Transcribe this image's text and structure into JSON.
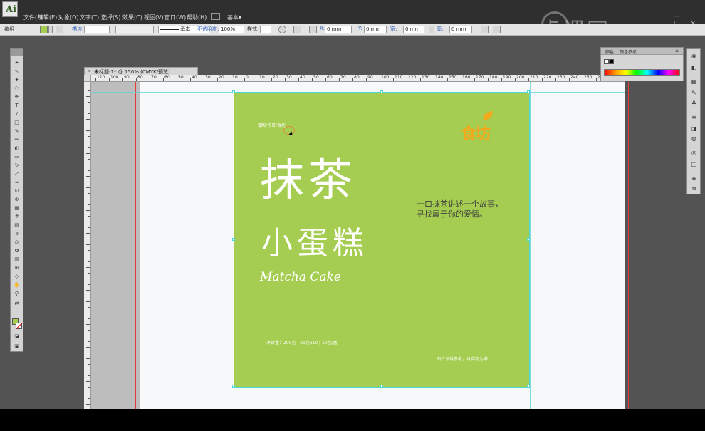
{
  "app": {
    "logo_letter": "Ai",
    "menu": [
      "文件(F)",
      "编辑(E)",
      "对象(O)",
      "文字(T)",
      "选择(S)",
      "效果(C)",
      "视图(V)",
      "窗口(W)",
      "帮助(H)"
    ],
    "workspace": "基本",
    "window_buttons": "— □ ×",
    "watermark": "虎课网"
  },
  "control_bar": {
    "selection_label": "编组",
    "stroke_label": "描边:",
    "stroke_style": "基本",
    "opacity_label": "不透明度:",
    "opacity_value": "100%",
    "style_label": "样式:",
    "x_label": "X:",
    "x_value": "0 mm",
    "y_label": "Y:",
    "y_value": "0 mm",
    "w_label": "宽:",
    "w_value": "0 mm",
    "h_label": "高:",
    "h_value": "0 mm",
    "fill_color": "#a5cd51"
  },
  "document": {
    "tab_title": "未标题-1* @ 150% (CMYK/预览)",
    "ruler_ticks": [
      "110",
      "100",
      "90",
      "80",
      "70",
      "60",
      "50",
      "40",
      "30",
      "20",
      "10",
      "0",
      "10",
      "20",
      "30",
      "40",
      "50",
      "60",
      "70",
      "80",
      "90",
      "100",
      "110",
      "120",
      "130",
      "140",
      "150",
      "160",
      "170",
      "180",
      "190",
      "200",
      "210",
      "220",
      "230",
      "240",
      "250",
      "260",
      "270",
      "280"
    ]
  },
  "panels": {
    "swatch_tab1": "颜色",
    "swatch_tab2": "颜色参考"
  },
  "design": {
    "background_color": "#a5cd51",
    "brand_line": "御坊作茶/食坊",
    "logo_text": "食坊",
    "title_line1": "抹茶",
    "title_line2": "小蛋糕",
    "subtitle_en": "Matcha Cake",
    "tagline_line1": "一口抹茶讲述一个故事，",
    "tagline_line2": "寻找属于你的爱情。",
    "net_content": "净含量：290克 | 29克x10 | 10包/盒",
    "disclaimer": "图片仅供参考，以实物为准"
  }
}
